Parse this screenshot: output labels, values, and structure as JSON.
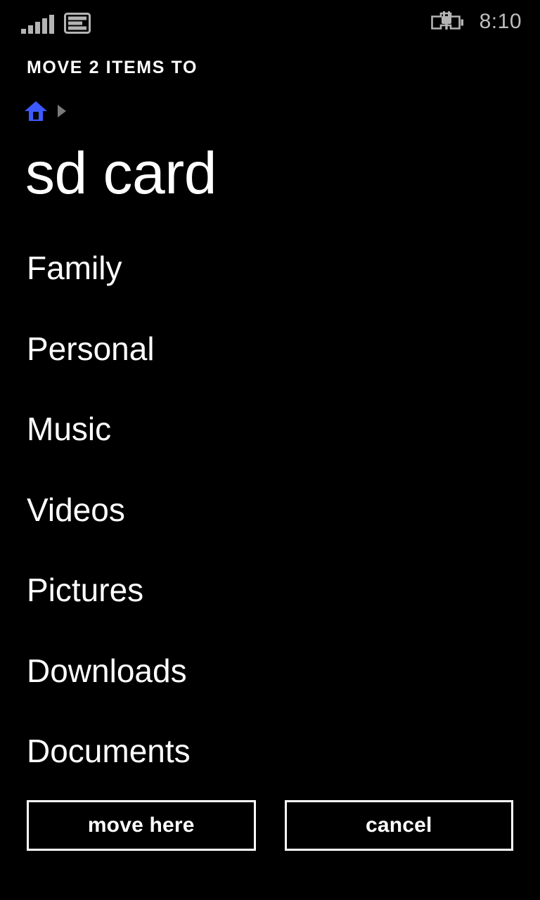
{
  "theme": {
    "background": "#000000",
    "foreground": "#ffffff",
    "status_icon_color": "#b4b4b4",
    "accent_blue": "#3d5afe",
    "crumb_arrow_color": "#7a7a7a"
  },
  "status_bar": {
    "signal_icon": "signal-bars-icon",
    "signal_bars_filled": 5,
    "data_icon": "sim-card-icon",
    "battery_icon": "battery-charging-icon",
    "time": "8:10"
  },
  "header": {
    "title": "MOVE 2 ITEMS TO"
  },
  "breadcrumb": {
    "home_icon": "home-icon",
    "separator_icon": "triangle-right-icon",
    "items": [
      {
        "label": "",
        "icon": "home-icon"
      }
    ]
  },
  "page": {
    "title": "sd card"
  },
  "folders": [
    {
      "label": "Family"
    },
    {
      "label": "Personal"
    },
    {
      "label": "Music"
    },
    {
      "label": "Videos"
    },
    {
      "label": "Pictures"
    },
    {
      "label": "Downloads"
    },
    {
      "label": "Documents"
    }
  ],
  "actions": {
    "primary_label": "move here",
    "secondary_label": "cancel"
  }
}
